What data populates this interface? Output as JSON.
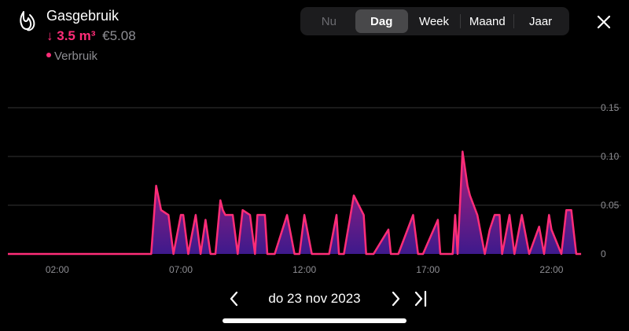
{
  "header": {
    "title": "Gasgebruik",
    "arrow": "↓",
    "amount": "3.5 m³",
    "cost": "€5.08",
    "legend_label": "Verbruik",
    "icon": "flame-icon"
  },
  "period_tabs": [
    {
      "label": "Nu",
      "state": "disabled"
    },
    {
      "label": "Dag",
      "state": "active"
    },
    {
      "label": "Week",
      "state": "normal"
    },
    {
      "label": "Maand",
      "state": "normal"
    },
    {
      "label": "Jaar",
      "state": "normal"
    }
  ],
  "close_icon": "close-icon",
  "navigation": {
    "date": "do 23 nov 2023",
    "prev_icon": "chevron-left-icon",
    "next_icon": "chevron-right-icon",
    "last_icon": "skip-to-end-icon"
  },
  "colors": {
    "accent": "#ff2d78",
    "fill": "#5a1a8c",
    "background": "#000000"
  },
  "chart_data": {
    "type": "area",
    "series": [
      {
        "name": "Verbruik",
        "x": [
          0,
          5.8,
          6.0,
          6.2,
          6.5,
          6.7,
          7.0,
          7.1,
          7.3,
          7.6,
          7.8,
          8.0,
          8.2,
          8.4,
          8.6,
          8.7,
          8.8,
          9.0,
          9.1,
          9.3,
          9.5,
          9.8,
          10.0,
          10.1,
          10.4,
          10.5,
          10.8,
          11.3,
          11.6,
          11.8,
          12.0,
          12.3,
          13.0,
          13.3,
          13.4,
          13.6,
          14.0,
          14.4,
          14.5,
          14.8,
          15.4,
          15.5,
          15.8,
          16.4,
          16.6,
          16.8,
          17.4,
          17.5,
          17.7,
          18.0,
          18.1,
          18.2,
          18.4,
          18.6,
          18.7,
          19.0,
          19.3,
          19.5,
          19.7,
          19.9,
          20.0,
          20.3,
          20.5,
          20.8,
          21.1,
          21.5,
          21.7,
          21.9,
          22.0,
          22.4,
          22.6,
          22.8,
          23.0,
          23.2
        ],
        "values": [
          0,
          0,
          0.07,
          0.045,
          0.04,
          0,
          0.04,
          0.04,
          0,
          0.04,
          0,
          0.035,
          0,
          0,
          0.055,
          0.045,
          0.04,
          0.04,
          0.04,
          0,
          0.045,
          0.04,
          0,
          0.04,
          0.04,
          0,
          0,
          0.04,
          0,
          0,
          0.04,
          0,
          0,
          0.04,
          0,
          0,
          0.06,
          0.04,
          0,
          0,
          0.025,
          0,
          0,
          0.04,
          0,
          0,
          0.035,
          0,
          0,
          0,
          0.04,
          0,
          0.105,
          0.07,
          0.06,
          0.04,
          0,
          0.025,
          0.04,
          0.04,
          0,
          0.04,
          0,
          0.04,
          0,
          0.028,
          0,
          0.04,
          0.025,
          0,
          0.045,
          0.045,
          0,
          0
        ]
      }
    ],
    "xlim": [
      0,
      23.8
    ],
    "ylim": [
      0,
      0.15
    ],
    "x_ticks": [
      {
        "value": 2,
        "label": "02:00"
      },
      {
        "value": 7,
        "label": "07:00"
      },
      {
        "value": 12,
        "label": "12:00"
      },
      {
        "value": 17,
        "label": "17:00"
      },
      {
        "value": 22,
        "label": "22:00"
      }
    ],
    "y_ticks": [
      {
        "value": 0,
        "label": "0"
      },
      {
        "value": 0.05,
        "label": "0.05"
      },
      {
        "value": 0.1,
        "label": "0.10"
      },
      {
        "value": 0.15,
        "label": "0.15"
      }
    ],
    "grid": true,
    "y_axis_side": "right"
  }
}
